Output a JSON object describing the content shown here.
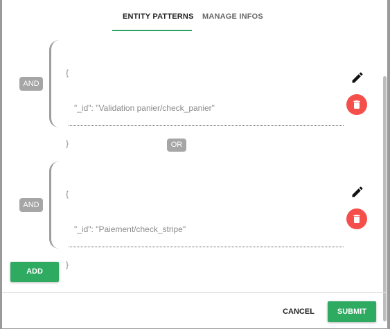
{
  "tabs": [
    {
      "label": "ENTITY PATTERNS",
      "active": true
    },
    {
      "label": "MANAGE INFOS",
      "active": false
    }
  ],
  "patterns": [
    {
      "and_label": "AND",
      "open_brace": "{",
      "id_line": "\"_id\": \"Validation panier/check_panier\"",
      "close_brace": "}"
    },
    {
      "and_label": "AND",
      "open_brace": "{",
      "id_line": "\"_id\": \"Paiement/check_stripe\"",
      "close_brace": "}"
    }
  ],
  "or_label": "OR",
  "add_label": "ADD",
  "footer": {
    "cancel_label": "CANCEL",
    "submit_label": "SUBMIT"
  },
  "colors": {
    "accent": "#2eaa61",
    "delete": "#f44f4a",
    "badge": "#a6a6a6"
  },
  "icons": {
    "edit": "pencil-icon",
    "delete": "trash-icon"
  }
}
